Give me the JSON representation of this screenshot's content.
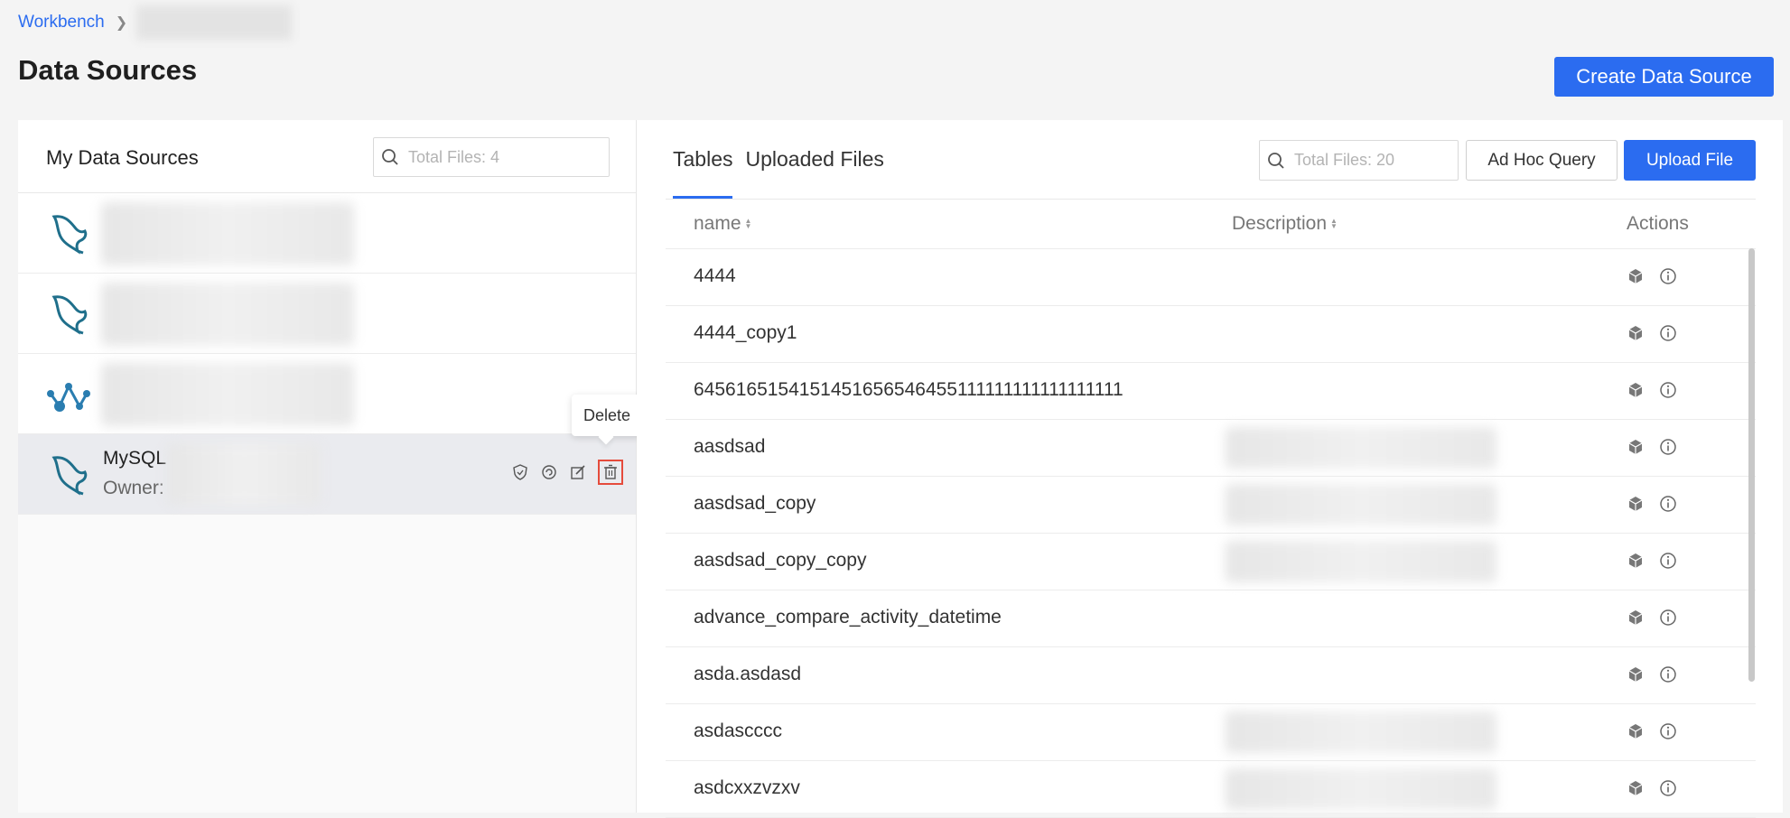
{
  "breadcrumb": {
    "root": "Workbench"
  },
  "page": {
    "title": "Data Sources",
    "create_button": "Create Data Source"
  },
  "left": {
    "title": "My Data Sources",
    "search_placeholder": "Total Files: 4",
    "active_item": {
      "name": "MySQL",
      "owner_label": "Owner:"
    },
    "tooltip": "Delete",
    "icons": [
      "mysql-dolphin-icon",
      "mysql-dolphin-icon",
      "graph-network-icon",
      "mysql-dolphin-icon"
    ]
  },
  "right": {
    "tabs": [
      "Tables",
      "Uploaded Files"
    ],
    "search_placeholder": "Total Files: 20",
    "adhoc_button": "Ad Hoc Query",
    "upload_button": "Upload File",
    "columns": {
      "name": "name",
      "description": "Description",
      "actions": "Actions"
    },
    "rows": [
      "4444",
      "4444_copy1",
      "6456165154151451656546455111111111111111111",
      "aasdsad",
      "aasdsad_copy",
      "aasdsad_copy_copy",
      "advance_compare_activity_datetime",
      "asda.asdasd",
      "asdascccc",
      "asdcxxzvzxv"
    ]
  },
  "colors": {
    "accent": "#2b6cf0",
    "danger_outline": "#e54b3c",
    "mysql_icon": "#1f6f8b"
  }
}
